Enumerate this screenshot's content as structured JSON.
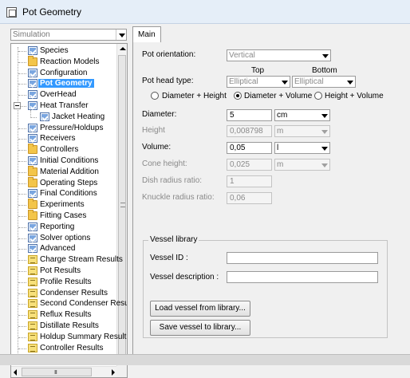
{
  "window": {
    "title": "Pot Geometry"
  },
  "left_panel": {
    "simulation_select": {
      "value": "Simulation"
    },
    "tree_items": [
      {
        "label": "Species",
        "icon": "form-icon"
      },
      {
        "label": "Reaction Models",
        "icon": "folder-icon"
      },
      {
        "label": "Configuration",
        "icon": "form-icon"
      },
      {
        "label": "Pot Geometry",
        "icon": "form-icon",
        "selected": true
      },
      {
        "label": "OverHead",
        "icon": "form-icon"
      },
      {
        "label": "Heat Transfer",
        "icon": "form-icon",
        "expanded": true
      },
      {
        "label": "Jacket Heating",
        "icon": "form-icon",
        "child": true
      },
      {
        "label": "Pressure/Holdups",
        "icon": "form-icon"
      },
      {
        "label": "Receivers",
        "icon": "form-icon"
      },
      {
        "label": "Controllers",
        "icon": "folder-icon"
      },
      {
        "label": "Initial Conditions",
        "icon": "form-icon"
      },
      {
        "label": "Material Addition",
        "icon": "folder-icon"
      },
      {
        "label": "Operating Steps",
        "icon": "folder-icon"
      },
      {
        "label": "Final Conditions",
        "icon": "form-icon"
      },
      {
        "label": "Experiments",
        "icon": "folder-icon"
      },
      {
        "label": "Fitting Cases",
        "icon": "folder-icon"
      },
      {
        "label": "Reporting",
        "icon": "form-icon"
      },
      {
        "label": "Solver options",
        "icon": "form-icon"
      },
      {
        "label": "Advanced",
        "icon": "form-icon"
      },
      {
        "label": "Charge Stream Results",
        "icon": "results-icon"
      },
      {
        "label": "Pot Results",
        "icon": "results-icon"
      },
      {
        "label": "Profile Results",
        "icon": "results-icon"
      },
      {
        "label": "Condenser Results",
        "icon": "results-icon"
      },
      {
        "label": "Second Condenser Resu",
        "icon": "results-icon"
      },
      {
        "label": "Reflux Results",
        "icon": "results-icon"
      },
      {
        "label": "Distillate Results",
        "icon": "results-icon"
      },
      {
        "label": "Holdup Summary Result",
        "icon": "results-icon"
      },
      {
        "label": "Controller Results",
        "icon": "results-icon"
      }
    ],
    "hscroll_grip": "III"
  },
  "main": {
    "tab_label": "Main",
    "pot_orientation": {
      "label": "Pot orientation:",
      "value": "Vertical"
    },
    "col_top": "Top",
    "col_bottom": "Bottom",
    "pot_head_type": {
      "label": "Pot head type:",
      "top_value": "Elliptical",
      "bottom_value": "Elliptical"
    },
    "radio_options": [
      {
        "label": "Diameter + Height",
        "selected": false
      },
      {
        "label": "Diameter + Volume",
        "selected": true
      },
      {
        "label": "Height + Volume",
        "selected": false
      }
    ],
    "diameter": {
      "label": "Diameter:",
      "value": "5",
      "unit": "cm"
    },
    "height": {
      "label": "Height",
      "value": "0,008798",
      "unit": "m"
    },
    "volume": {
      "label": "Volume:",
      "value": "0,05",
      "unit": "l"
    },
    "cone_height": {
      "label": "Cone height:",
      "value": "0,025",
      "unit": "m"
    },
    "dish_radius": {
      "label": "Dish radius ratio:",
      "value": "1"
    },
    "knuckle_radius": {
      "label": "Knuckle radius ratio:",
      "value": "0,06"
    },
    "vessel_library": {
      "legend": "Vessel library",
      "vessel_id_label": "Vessel ID :",
      "vessel_id_value": "",
      "vessel_desc_label": "Vessel description :",
      "vessel_desc_value": "",
      "load_button": "Load vessel from library...",
      "save_button": "Save vessel to library..."
    }
  }
}
